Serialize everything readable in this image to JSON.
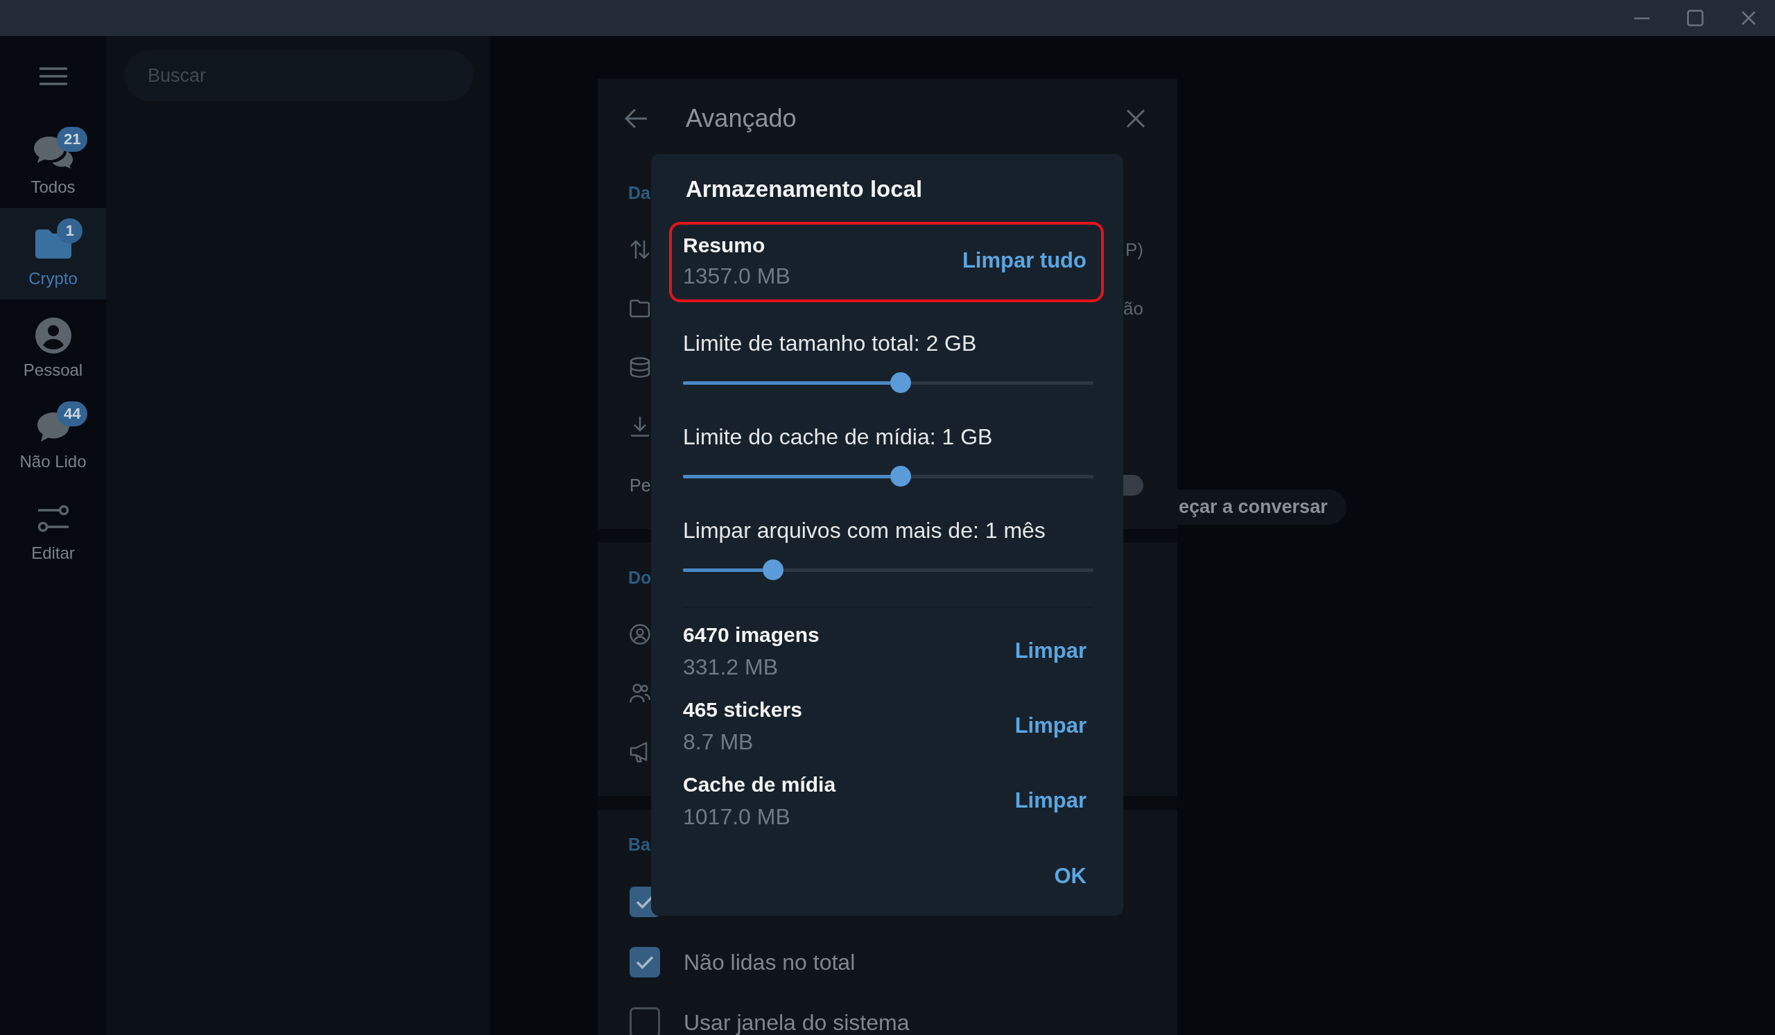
{
  "sidebar": {
    "items": [
      {
        "label": "Todos",
        "badge": "21",
        "selected": false
      },
      {
        "label": "Crypto",
        "badge": "1",
        "selected": true
      },
      {
        "label": "Pessoal",
        "selected": false
      },
      {
        "label": "Não Lido",
        "badge": "44",
        "selected": false
      },
      {
        "label": "Editar",
        "selected": false
      }
    ]
  },
  "search": {
    "placeholder": "Buscar"
  },
  "settings_panel": {
    "title": "Avançado",
    "sections": [
      {
        "header": "Da",
        "rows": [
          {
            "kind": "icon",
            "value": "P)"
          },
          {
            "kind": "icon",
            "value": "ão"
          },
          {
            "kind": "icon"
          },
          {
            "kind": "icon"
          },
          {
            "kind": "toggle",
            "label": "Pe",
            "on": false
          }
        ]
      },
      {
        "header": "Do",
        "rows": [
          {
            "kind": "icon"
          },
          {
            "kind": "icon"
          },
          {
            "kind": "icon"
          }
        ]
      },
      {
        "header": "Ba",
        "rows": [
          {
            "kind": "checkbox",
            "checked": true
          },
          {
            "kind": "checkbox",
            "checked": true,
            "label": "Não lidas no total"
          },
          {
            "kind": "checkbox",
            "checked": false,
            "label": "Usar janela do sistema"
          }
        ]
      }
    ]
  },
  "chat_area": {
    "hint": "eçar a conversar"
  },
  "dialog": {
    "title": "Armazenamento local",
    "summary": {
      "title": "Resumo",
      "size": "1357.0 MB",
      "action": "Limpar tudo",
      "highlighted": true
    },
    "sliders": [
      {
        "label": "Limite de tamanho total: 2 GB",
        "level": 0.53
      },
      {
        "label": "Limite do cache de mídia: 1 GB",
        "level": 0.53
      },
      {
        "label": "Limpar arquivos com mais de: 1 mês",
        "level": 0.22
      }
    ],
    "categories": [
      {
        "title": "6470 imagens",
        "size": "331.2 MB",
        "action": "Limpar"
      },
      {
        "title": "465 stickers",
        "size": "8.7 MB",
        "action": "Limpar"
      },
      {
        "title": "Cache de mídia",
        "size": "1017.0 MB",
        "action": "Limpar"
      }
    ],
    "buttons": [
      "OK"
    ]
  }
}
